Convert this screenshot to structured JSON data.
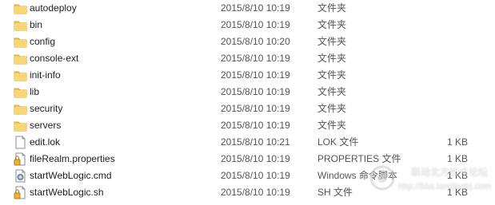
{
  "files": [
    {
      "name": "autodeploy",
      "date": "2015/8/10 10:19",
      "type": "文件夹",
      "size": "",
      "icon": "folder-icon"
    },
    {
      "name": "bin",
      "date": "2015/8/10 10:19",
      "type": "文件夹",
      "size": "",
      "icon": "folder-icon"
    },
    {
      "name": "config",
      "date": "2015/8/10 10:20",
      "type": "文件夹",
      "size": "",
      "icon": "folder-icon"
    },
    {
      "name": "console-ext",
      "date": "2015/8/10 10:19",
      "type": "文件夹",
      "size": "",
      "icon": "folder-icon"
    },
    {
      "name": "init-info",
      "date": "2015/8/10 10:19",
      "type": "文件夹",
      "size": "",
      "icon": "folder-icon"
    },
    {
      "name": "lib",
      "date": "2015/8/10 10:19",
      "type": "文件夹",
      "size": "",
      "icon": "folder-icon"
    },
    {
      "name": "security",
      "date": "2015/8/10 10:19",
      "type": "文件夹",
      "size": "",
      "icon": "folder-icon"
    },
    {
      "name": "servers",
      "date": "2015/8/10 10:19",
      "type": "文件夹",
      "size": "",
      "icon": "folder-icon"
    },
    {
      "name": "edit.lok",
      "date": "2015/8/10 10:21",
      "type": "LOK 文件",
      "size": "1 KB",
      "icon": "file-icon"
    },
    {
      "name": "fileRealm.properties",
      "date": "2015/8/10 10:19",
      "type": "PROPERTIES 文件",
      "size": "1 KB",
      "icon": "locked-file-icon"
    },
    {
      "name": "startWebLogic.cmd",
      "date": "2015/8/10 10:19",
      "type": "Windows 命令脚本",
      "size": "1 KB",
      "icon": "cmd-script-icon"
    },
    {
      "name": "startWebLogic.sh",
      "date": "2015/8/10 10:19",
      "type": "SH 文件",
      "size": "1 KB",
      "icon": "locked-file-icon"
    }
  ],
  "watermark": {
    "line1": "联动北方技术论坛",
    "line2": "http://bbs.landingbj.com"
  },
  "colors": {
    "folder_fill": "#f2c75a",
    "folder_dark": "#d9a63a"
  }
}
